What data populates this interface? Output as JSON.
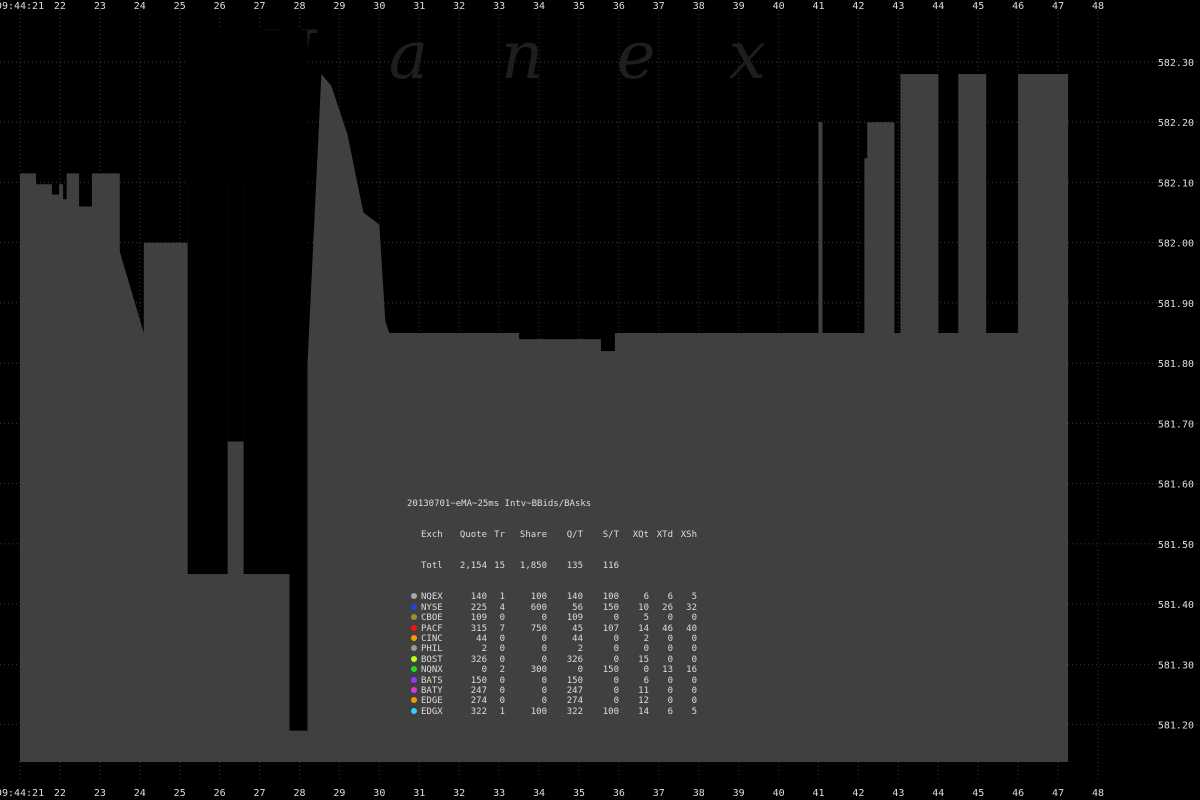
{
  "colors": {
    "background": "#000000",
    "area": "#404040",
    "grid": "#3a3a3a",
    "text": "#dddddd",
    "NQEX": "#a8a8a8",
    "NYSE": "#2b3fe0",
    "CBOE": "#9a8f2a",
    "PACF": "#ff1010",
    "CINC": "#ff9900",
    "PHIL": "#9a9a9a",
    "BOST": "#b8ff20",
    "NQNX": "#22dd22",
    "BATS": "#9933ff",
    "BATY": "#dd33dd",
    "EDGE": "#e8a000",
    "EDGX": "#33ccff"
  },
  "watermark": "N a n e x",
  "chart_data": {
    "type": "area",
    "x_start_label": "09:44:21",
    "x_tick_labels": [
      "09:44:21",
      "22",
      "23",
      "24",
      "25",
      "26",
      "27",
      "28",
      "29",
      "30",
      "31",
      "32",
      "33",
      "34",
      "35",
      "36",
      "37",
      "38",
      "39",
      "40",
      "41",
      "42",
      "43",
      "44",
      "45",
      "46",
      "47",
      "48"
    ],
    "y_tick_labels": [
      "582.30",
      "582.20",
      "582.10",
      "582.00",
      "581.90",
      "581.80",
      "581.70",
      "581.60",
      "581.50",
      "581.40",
      "581.30",
      "581.20"
    ],
    "y_ticks": [
      582.3,
      582.2,
      582.1,
      582.0,
      581.9,
      581.8,
      581.7,
      581.6,
      581.5,
      581.4,
      581.3,
      581.2
    ],
    "ylim": [
      581.138,
      582.353
    ],
    "xlim": [
      21.0,
      48.0
    ],
    "grid": true,
    "series": [
      {
        "name": "Best Bid",
        "x": [
          21.0,
          21.4,
          21.4,
          21.8,
          21.8,
          21.98,
          21.98,
          22.08,
          22.08,
          22.17,
          22.17,
          22.48,
          22.48,
          22.8,
          22.8,
          23.5,
          23.5,
          24.1,
          24.1,
          24.23,
          24.23,
          25.2,
          25.2,
          26.2,
          26.2,
          26.8,
          26.8,
          27.4,
          27.4,
          27.6,
          27.6,
          27.75,
          27.75,
          28.2,
          28.2,
          28.55,
          28.55,
          28.8,
          28.8,
          29.2,
          29.2,
          29.6,
          29.6,
          30.0,
          30.0,
          30.15,
          30.15,
          30.25,
          30.25,
          31.0,
          33.5,
          33.5,
          35.55,
          35.55,
          35.9,
          35.9,
          38.5,
          38.5,
          40.8,
          40.8,
          41.0,
          41.0,
          41.1,
          41.1,
          42.15,
          42.15,
          42.22,
          42.22,
          42.9,
          42.9,
          43.05,
          43.05,
          44.0,
          44.0,
          44.5,
          44.5,
          45.2,
          45.2,
          46.0,
          46.0,
          47.25
        ],
        "y": [
          582.115,
          582.115,
          582.097,
          582.097,
          582.08,
          582.08,
          582.097,
          582.097,
          582.072,
          582.072,
          582.115,
          582.115,
          582.06,
          582.06,
          582.115,
          582.115,
          581.985,
          581.85,
          582.0,
          582.0,
          582.0,
          582.0,
          582.1,
          582.1,
          582.1,
          582.1,
          582.1,
          581.89,
          581.89,
          581.87,
          581.87,
          582.115,
          582.115,
          581.8,
          581.8,
          582.28,
          582.28,
          582.26,
          582.26,
          582.18,
          582.18,
          582.05,
          582.05,
          582.03,
          582.03,
          581.87,
          581.87,
          581.85,
          581.85,
          581.85,
          581.85,
          581.84,
          581.84,
          581.82,
          581.82,
          581.85,
          581.85,
          581.85,
          581.85,
          581.85,
          581.85,
          582.2,
          582.2,
          581.85,
          581.85,
          582.14,
          582.14,
          582.2,
          582.2,
          581.85,
          581.85,
          582.28,
          582.28,
          581.85,
          581.85,
          582.28,
          582.28,
          581.85,
          581.85,
          582.28,
          582.28
        ]
      }
    ],
    "low_segments": [
      {
        "x0": 25.2,
        "x1": 26.2,
        "y": 581.45
      },
      {
        "x0": 26.2,
        "x1": 26.6,
        "y": 581.67
      },
      {
        "x0": 26.6,
        "x1": 27.75,
        "y": 581.45
      },
      {
        "x0": 27.75,
        "x1": 28.2,
        "y": 581.19
      }
    ]
  },
  "stats_table": {
    "title": "20130701~eMA~25ms Intv~BBids/BAsks",
    "headers": [
      "Exch",
      "Quote",
      "Tr",
      "Share",
      "Q/T",
      "S/T",
      "XQt",
      "XTd",
      "XSh"
    ],
    "total": [
      "Totl",
      "2,154",
      "15",
      "1,850",
      "135",
      "116",
      "",
      "",
      ""
    ],
    "rows": [
      {
        "exch": "NQEX",
        "cells": [
          "140",
          "1",
          "100",
          "140",
          "100",
          "6",
          "6",
          "5"
        ],
        "marker": "NQEX"
      },
      {
        "exch": "NYSE",
        "cells": [
          "225",
          "4",
          "600",
          "56",
          "150",
          "10",
          "26",
          "32"
        ],
        "marker": "NYSE"
      },
      {
        "exch": "CBOE",
        "cells": [
          "109",
          "0",
          "0",
          "109",
          "0",
          "5",
          "0",
          "0"
        ],
        "marker": "CBOE"
      },
      {
        "exch": "PACF",
        "cells": [
          "315",
          "7",
          "750",
          "45",
          "107",
          "14",
          "46",
          "40"
        ],
        "marker": "PACF"
      },
      {
        "exch": "CINC",
        "cells": [
          "44",
          "0",
          "0",
          "44",
          "0",
          "2",
          "0",
          "0"
        ],
        "marker": "CINC"
      },
      {
        "exch": "PHIL",
        "cells": [
          "2",
          "0",
          "0",
          "2",
          "0",
          "0",
          "0",
          "0"
        ],
        "marker": "PHIL"
      },
      {
        "exch": "BOST",
        "cells": [
          "326",
          "0",
          "0",
          "326",
          "0",
          "15",
          "0",
          "0"
        ],
        "marker": "BOST"
      },
      {
        "exch": "NQNX",
        "cells": [
          "0",
          "2",
          "300",
          "0",
          "150",
          "0",
          "13",
          "16"
        ],
        "marker": "NQNX"
      },
      {
        "exch": "BATS",
        "cells": [
          "150",
          "0",
          "0",
          "150",
          "0",
          "6",
          "0",
          "0"
        ],
        "marker": "BATS"
      },
      {
        "exch": "BATY",
        "cells": [
          "247",
          "0",
          "0",
          "247",
          "0",
          "11",
          "0",
          "0"
        ],
        "marker": "BATY"
      },
      {
        "exch": "EDGE",
        "cells": [
          "274",
          "0",
          "0",
          "274",
          "0",
          "12",
          "0",
          "0"
        ],
        "marker": "EDGE"
      },
      {
        "exch": "EDGX",
        "cells": [
          "322",
          "1",
          "100",
          "322",
          "100",
          "14",
          "6",
          "5"
        ],
        "marker": "EDGX"
      }
    ]
  }
}
